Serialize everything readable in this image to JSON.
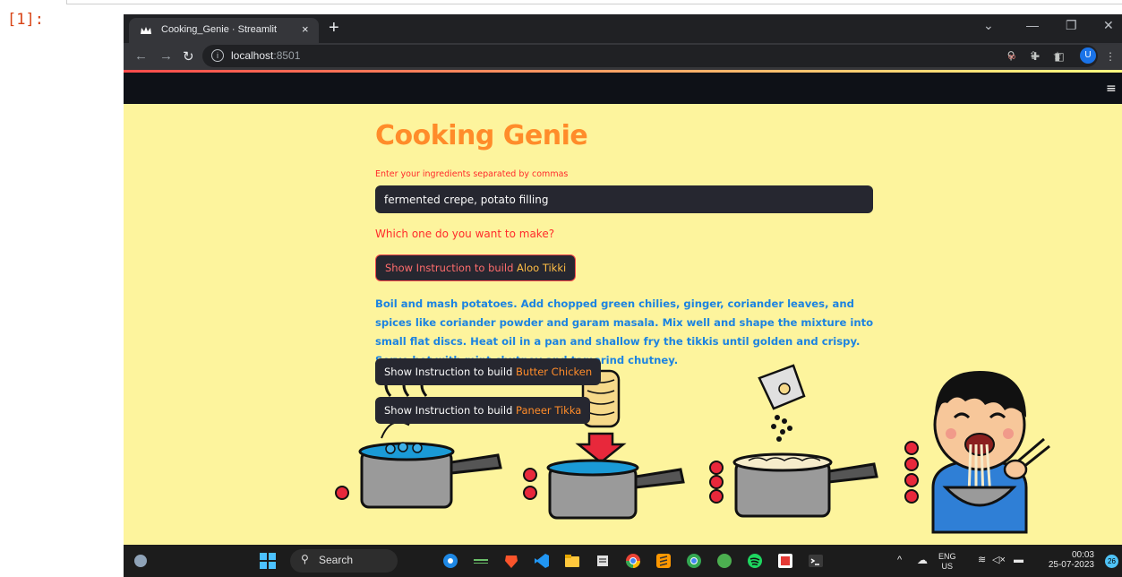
{
  "notebook": {
    "prompt": "[1]:"
  },
  "browser": {
    "tab_title": "Cooking_Genie · Streamlit",
    "tab_close": "×",
    "new_tab": "+",
    "url_host": "localhost",
    "url_port": ":8501",
    "profile_initial": "U"
  },
  "streamlit": {
    "menu_glyph": "≡"
  },
  "app": {
    "title": "Cooking Genie",
    "ingredients_label": "Enter your ingredients separated by commas",
    "ingredients_value": "fermented crepe, potato filling",
    "question": "Which one do you want to make?",
    "button_prefix": "Show Instruction to build ",
    "dishes": [
      "Aloo Tikki",
      "Butter Chicken",
      "Paneer Tikka"
    ],
    "recipe": "Boil and mash potatoes. Add chopped green chilies, ginger, coriander leaves, and spices like coriander powder and garam masala. Mix well and shape the mixture into small flat discs. Heat oil in a pan and shallow fry the tikkis until golden and crispy. Serve hot with mint chutney and tamarind chutney."
  },
  "taskbar": {
    "search_placeholder": "Search",
    "lang_top": "ENG",
    "lang_bottom": "US",
    "time": "00:03",
    "date": "25-07-2023",
    "notification_count": "26"
  },
  "colors": {
    "app_background": "#fdf49d",
    "title": "#ff8c2a",
    "label_red": "#ff2b2b",
    "recipe_blue": "#1c83e1",
    "button_bg": "#262730",
    "dish_orange": "#ff8c2a"
  }
}
